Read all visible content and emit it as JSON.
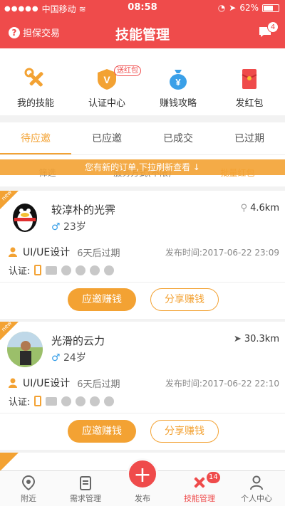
{
  "status_bar": {
    "carrier": "中国移动",
    "time": "08:58",
    "battery": "62%"
  },
  "nav": {
    "left_label": "担保交易",
    "title": "技能管理",
    "message_count": "4"
  },
  "quick_actions": [
    {
      "label": "我的技能",
      "icon": "tools-icon"
    },
    {
      "label": "认证中心",
      "icon": "certificate-icon"
    },
    {
      "label": "赚钱攻略",
      "icon": "money-bag-icon"
    },
    {
      "label": "发红包",
      "icon": "red-envelope-icon"
    }
  ],
  "cert_tag": "送红包",
  "tabs": [
    "待应邀",
    "已应邀",
    "已成交",
    "已过期"
  ],
  "filters": [
    "筛选",
    "服务方式(不限)",
    "批量红包"
  ],
  "banner": "您有新的订单,下拉刷新查看",
  "cards": [
    {
      "badge": "new",
      "name": "较淳朴的光霁",
      "age": "23岁",
      "distance": "4.6km",
      "skill": "UI/UE设计",
      "expire": "6天后过期",
      "published": "发布时间:2017-06-22 23:09",
      "cert_label": "认证:",
      "accept": "应邀赚钱",
      "share": "分享赚钱"
    },
    {
      "badge": "new",
      "name": "光滑的云力",
      "age": "24岁",
      "distance": "30.3km",
      "skill": "UI/UE设计",
      "expire": "6天后过期",
      "published": "发布时间:2017-06-22 22:10",
      "cert_label": "认证:",
      "accept": "应邀赚钱",
      "share": "分享赚钱"
    }
  ],
  "tabbar": {
    "items": [
      "附近",
      "需求管理",
      "发布",
      "技能管理",
      "个人中心"
    ],
    "skill_badge": "14"
  },
  "colors": {
    "primary": "#ef4b4b",
    "accent": "#f3a233"
  }
}
